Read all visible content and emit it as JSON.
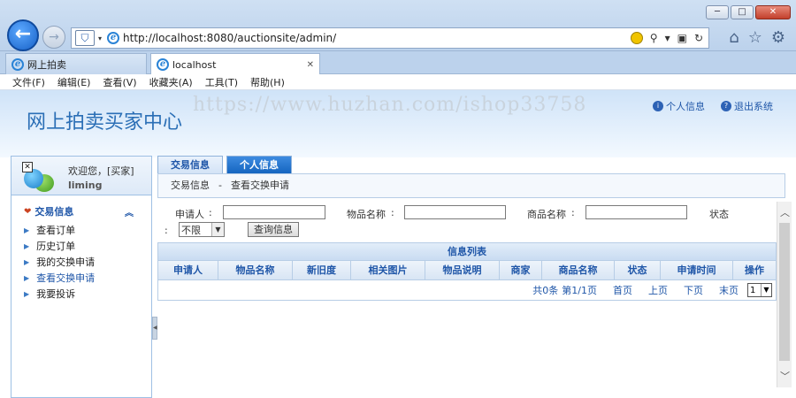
{
  "browser": {
    "url": "http://localhost:8080/auctionsite/admin/",
    "tabs": [
      {
        "title": "网上拍卖"
      },
      {
        "title": "localhost"
      }
    ],
    "menu": [
      "文件(F)",
      "编辑(E)",
      "查看(V)",
      "收藏夹(A)",
      "工具(T)",
      "帮助(H)"
    ],
    "window_controls": [
      "─",
      "□",
      "✕"
    ]
  },
  "header": {
    "watermark": "https://www.huzhan.com/ishop33758",
    "title": "网上拍卖买家中心",
    "links": [
      {
        "label": "个人信息",
        "icon": "info-icon"
      },
      {
        "label": "退出系统",
        "icon": "help-icon"
      }
    ]
  },
  "sidebar": {
    "welcome": "欢迎您，[买家]",
    "username": "liming",
    "group_title": "交易信息",
    "items": [
      {
        "label": "查看订单"
      },
      {
        "label": "历史订单"
      },
      {
        "label": "我的交换申请"
      },
      {
        "label": "查看交换申请"
      },
      {
        "label": "我要投诉"
      }
    ]
  },
  "main": {
    "tabs": [
      {
        "label": "交易信息"
      },
      {
        "label": "个人信息"
      }
    ],
    "breadcrumb": {
      "part1": "交易信息",
      "sep": "-",
      "part2": "查看交换申请"
    },
    "filter": {
      "applicant_label": "申请人",
      "item_name_label": "物品名称",
      "goods_name_label": "商品名称",
      "status_label": "状态",
      "colon": ":",
      "status_value": "不限",
      "query_button": "查询信息"
    },
    "table": {
      "title": "信息列表",
      "columns": [
        "申请人",
        "物品名称",
        "新旧度",
        "相关图片",
        "物品说明",
        "商家",
        "商品名称",
        "状态",
        "申请时间",
        "操作"
      ]
    },
    "pager": {
      "total": "共0条",
      "page": "第1/1页",
      "first": "首页",
      "prev": "上页",
      "next": "下页",
      "last": "末页",
      "page_select": "1"
    }
  }
}
